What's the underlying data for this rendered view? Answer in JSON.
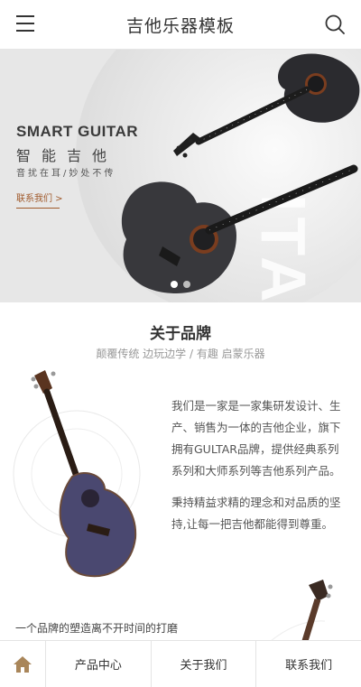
{
  "header": {
    "title": "吉他乐器模板",
    "menu_icon": "hamburger-menu-icon",
    "search_icon": "search-icon"
  },
  "banner": {
    "heading": "SMART GUITAR",
    "subheading": "智能吉他",
    "slogan": "音扰在耳/妙处不传",
    "link_label": "联系我们 >",
    "watermark": "ITAR",
    "slides": 2,
    "active_slide": 1
  },
  "about": {
    "title": "关于品牌",
    "subtitle": "颠覆传统 边玩边学 / 有趣 启蒙乐器",
    "paragraph1": "我们是一家是一家集研发设计、生产、销售为一体的吉他企业，旗下拥有GULTAR品牌，提供经典系列系列和大师系列等吉他系列产品。",
    "paragraph2": "秉持精益求精的理念和对品质的坚持,让每一把吉他都能得到尊重。",
    "slogan": "一个品牌的塑造离不开时间的打磨"
  },
  "nav": {
    "home_icon": "home-icon",
    "items": [
      "产品中心",
      "关于我们",
      "联系我们"
    ]
  },
  "colors": {
    "accent": "#a05a2c",
    "home_icon": "#a9865a"
  }
}
